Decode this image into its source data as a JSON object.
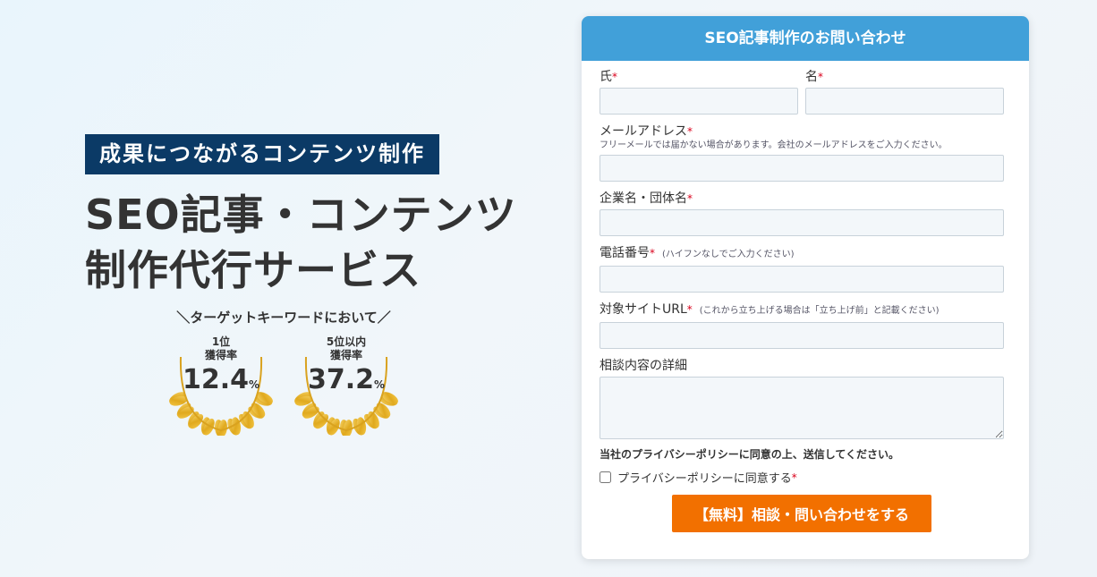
{
  "hero": {
    "badge": "成果につながるコンテンツ制作",
    "title_line1": "SEO記事・コンテンツ",
    "title_line2": "制作代行サービス",
    "awards_caption": "＼ターゲットキーワードにおいて／",
    "awards": [
      {
        "label1": "1位",
        "label2": "獲得率",
        "value": "12.4",
        "unit": "%"
      },
      {
        "label1": "5位以内",
        "label2": "獲得率",
        "value": "37.2",
        "unit": "%"
      }
    ]
  },
  "form": {
    "title": "SEO記事制作のお問い合わせ",
    "last_name_label": "氏",
    "first_name_label": "名",
    "required_mark": "*",
    "email_label": "メールアドレス",
    "email_hint": "フリーメールでは届かない場合があります。会社のメールアドレスをご入力ください。",
    "company_label": "企業名・団体名",
    "phone_label": "電話番号",
    "phone_hint": "(ハイフンなしでご入力ください)",
    "site_label": "対象サイトURL",
    "site_hint": "(これから立ち上げる場合は「立ち上げ前」と記載ください)",
    "detail_label": "相談内容の詳細",
    "privacy_notice": "当社のプライバシーポリシーに同意の上、送信してください。",
    "agree_label": "プライバシーポリシーに同意する",
    "submit_label": "【無料】相談・問い合わせをする"
  },
  "colors": {
    "header": "#41a0d9",
    "submit": "#f27000",
    "badge": "#0b3a66",
    "required": "#d9001b"
  }
}
